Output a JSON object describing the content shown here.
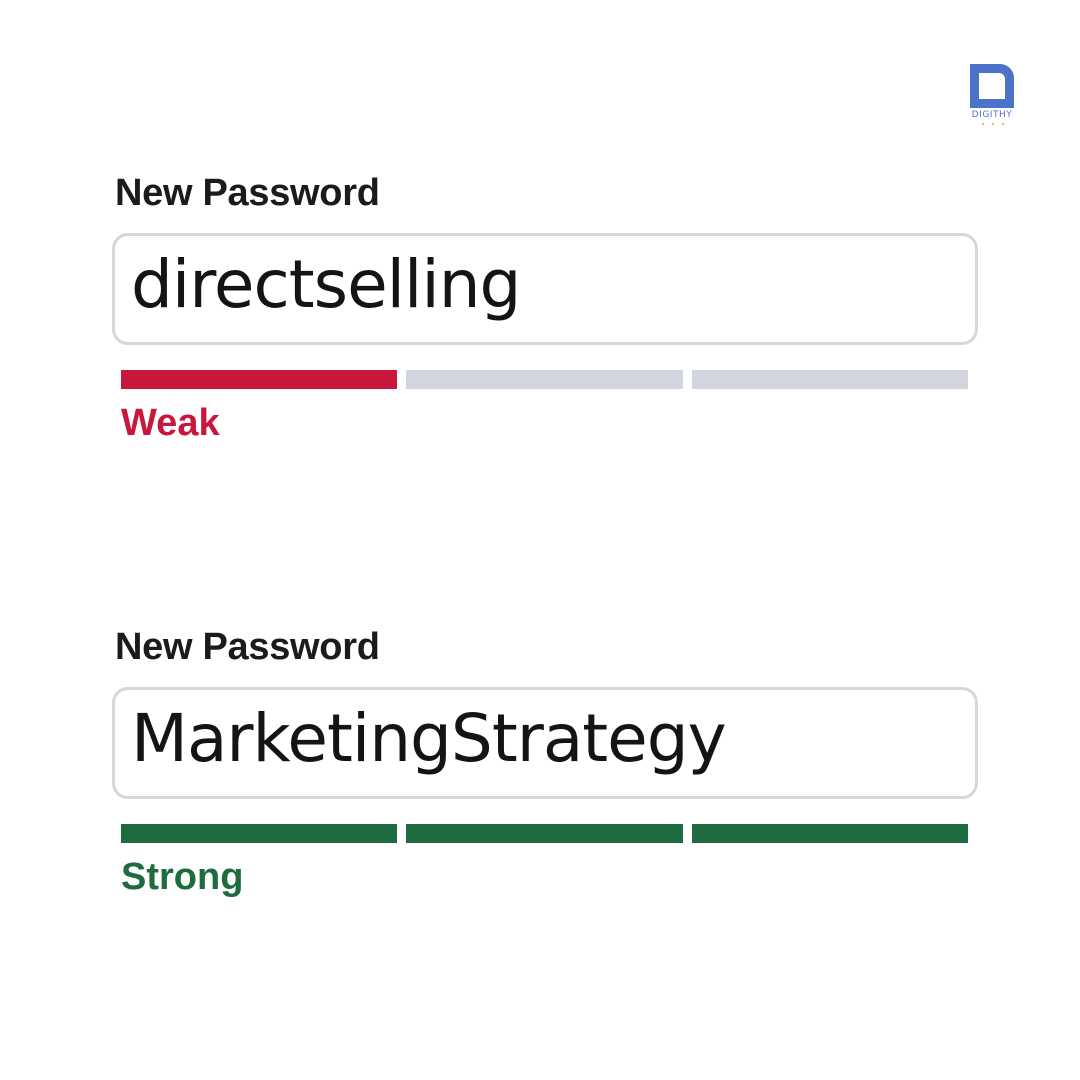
{
  "brand": {
    "logo_text": "DIGITHY",
    "logo_color": "#4a73c9"
  },
  "colors": {
    "weak": "#c8163d",
    "strong": "#1d6b3e",
    "empty": "#d2d5df",
    "input_border": "#d6d6de"
  },
  "fields": [
    {
      "label": "New Password",
      "value": "directselling",
      "strength_label": "Weak",
      "strength_level": 1,
      "strength_segments": 3,
      "strength_color": "#c8163d"
    },
    {
      "label": "New Password",
      "value": "MarketingStrategy",
      "strength_label": "Strong",
      "strength_level": 3,
      "strength_segments": 3,
      "strength_color": "#1d6b3e"
    }
  ]
}
